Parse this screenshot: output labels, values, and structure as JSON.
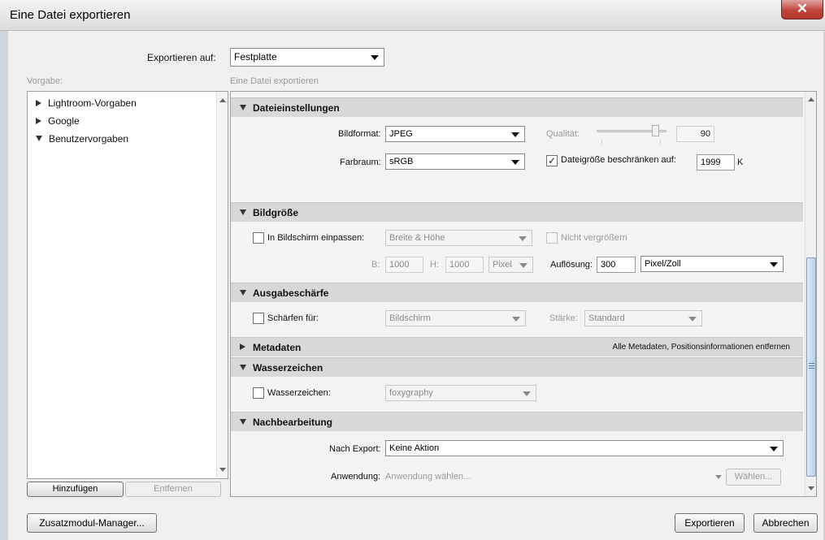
{
  "window": {
    "title": "Eine Datei exportieren",
    "close_glyph": "✕"
  },
  "export_to": {
    "label": "Exportieren auf:",
    "value": "Festplatte"
  },
  "presets": {
    "label": "Vorgabe:",
    "items": [
      {
        "label": "Lightroom-Vorgaben",
        "expanded": false
      },
      {
        "label": "Google",
        "expanded": false
      },
      {
        "label": "Benutzervorgaben",
        "expanded": true
      }
    ],
    "add_button": "Hinzufügen",
    "remove_button": "Entfernen"
  },
  "panel_label": "Eine Datei exportieren",
  "file_settings": {
    "title": "Dateieinstellungen",
    "format_label": "Bildformat:",
    "format_value": "JPEG",
    "quality_label": "Qualität:",
    "quality_value": "90",
    "colorspace_label": "Farbraum:",
    "colorspace_value": "sRGB",
    "limit_label": "Dateigröße beschränken auf:",
    "limit_checked": true,
    "limit_value": "1999",
    "limit_unit": "K",
    "check_glyph": "✓"
  },
  "image_size": {
    "title": "Bildgröße",
    "fit_label": "In Bildschirm einpassen:",
    "fit_value": "Breite & Höhe",
    "no_enlarge_label": "Nicht vergrößern",
    "w_label": "B:",
    "w_value": "1000",
    "h_label": "H:",
    "h_value": "1000",
    "unit_value": "Pixel",
    "res_label": "Auflösung:",
    "res_value": "300",
    "res_unit": "Pixel/Zoll"
  },
  "sharpening": {
    "title": "Ausgabeschärfe",
    "sharpen_label": "Schärfen für:",
    "sharpen_value": "Bildschirm",
    "amount_label": "Stärke:",
    "amount_value": "Standard"
  },
  "metadata": {
    "title": "Metadaten",
    "summary": "Alle Metadaten, Positionsinformationen entfernen"
  },
  "watermark": {
    "title": "Wasserzeichen",
    "label": "Wasserzeichen:",
    "value": "foxygraphy"
  },
  "post_processing": {
    "title": "Nachbearbeitung",
    "after_label": "Nach Export:",
    "after_value": "Keine Aktion",
    "app_label": "Anwendung:",
    "app_placeholder": "Anwendung wählen...",
    "choose_button": "Wählen..."
  },
  "footer": {
    "plugin_manager": "Zusatzmodul-Manager...",
    "export_button": "Exportieren",
    "cancel_button": "Abbrechen"
  }
}
